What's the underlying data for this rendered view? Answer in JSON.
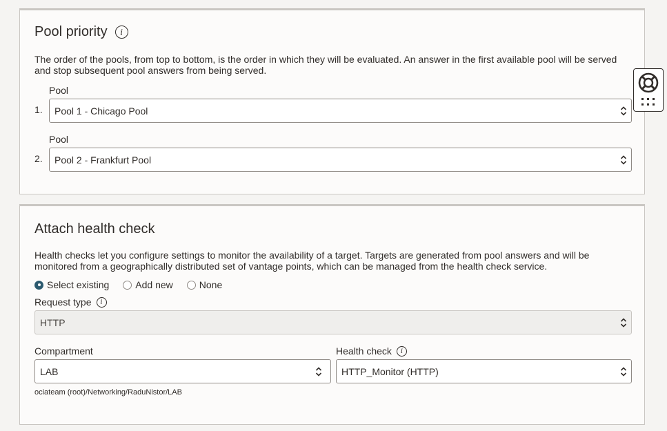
{
  "pool_priority": {
    "title": "Pool priority",
    "description": "The order of the pools, from top to bottom, is the order in which they will be evaluated. An answer in the first available pool will be served and stop subsequent pool answers from being served.",
    "pools": [
      {
        "index": "1.",
        "label": "Pool",
        "value": "Pool 1 - Chicago Pool"
      },
      {
        "index": "2.",
        "label": "Pool",
        "value": "Pool 2 - Frankfurt Pool"
      }
    ]
  },
  "health_check": {
    "title": "Attach health check",
    "description": "Health checks let you configure settings to monitor the availability of a target. Targets are generated from pool answers and will be monitored from a geographically distributed set of vantage points, which can be managed from the health check service.",
    "options": [
      "Select existing",
      "Add new",
      "None"
    ],
    "selected_option": "Select existing",
    "request_type_label": "Request type",
    "request_type_value": "HTTP",
    "compartment_label": "Compartment",
    "compartment_value": "LAB",
    "compartment_path": "ociateam (root)/Networking/RaduNistor/LAB",
    "health_check_label": "Health check",
    "health_check_value": "HTTP_Monitor (HTTP)"
  },
  "icons": {
    "info": "info-icon",
    "chevron": "chevron-up-down-icon",
    "help": "lifebuoy-icon",
    "apps": "grid-icon"
  },
  "colors": {
    "accent": "#2c5a6f",
    "panel_bg": "#fcfbfa",
    "page_bg": "#f5f4f2",
    "text": "#312d2a"
  }
}
